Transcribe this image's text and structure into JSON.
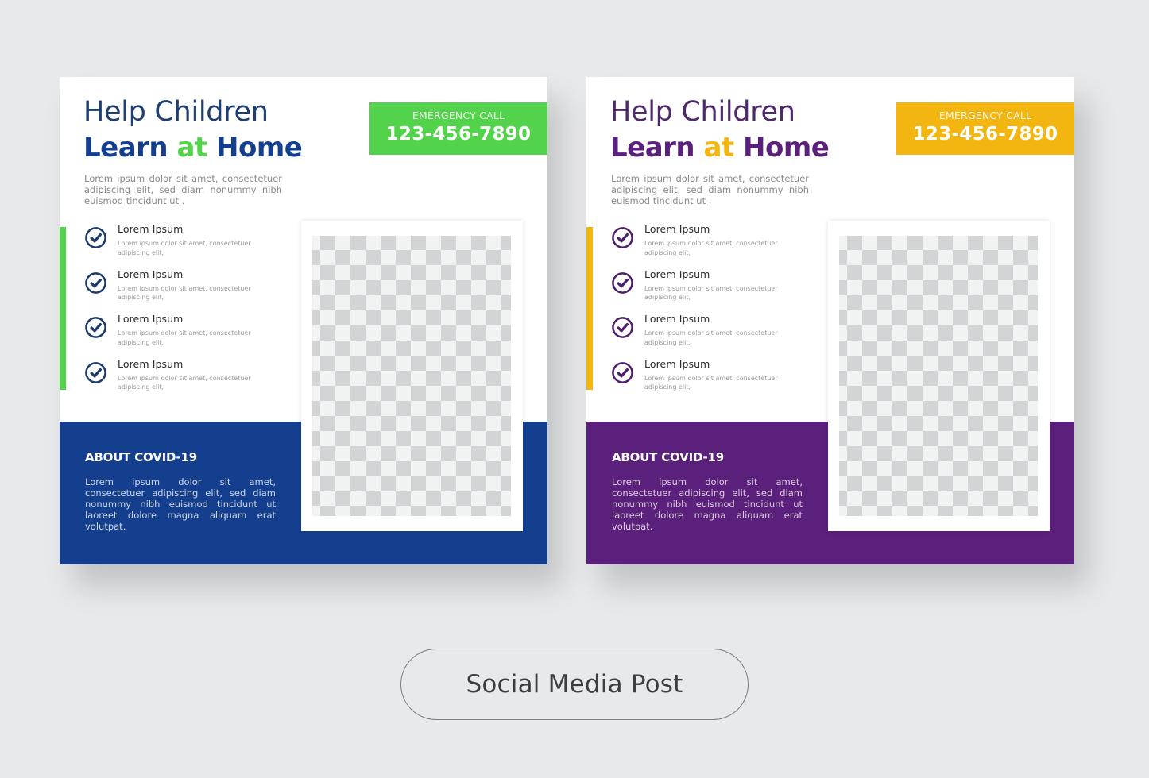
{
  "cards": [
    {
      "theme": {
        "primary": "#143f8f",
        "accent": "#52d34b",
        "headline_light": "#1d3f72",
        "check": "#1c3a6b"
      },
      "headline_line1": "Help Children",
      "headline_line2_part1": "Learn",
      "headline_line2_part2": "at",
      "headline_line2_part3": "Home",
      "intro": "Lorem ipsum dolor sit amet, consectetuer adipiscing elit, sed diam nonummy nibh euismod tincidunt ut .",
      "emergency_label": "EMERGENCY CALL",
      "emergency_phone": "123-456-7890",
      "list": [
        {
          "title": "Lorem Ipsum",
          "desc": "Lorem ipsum dolor sit amet, consectetuer adipiscing elit,",
          "icon": "check-circle-icon"
        },
        {
          "title": "Lorem Ipsum",
          "desc": "Lorem ipsum dolor sit amet, consectetuer adipiscing elit,",
          "icon": "check-circle-icon"
        },
        {
          "title": "Lorem Ipsum",
          "desc": "Lorem ipsum dolor sit amet, consectetuer adipiscing elit,",
          "icon": "check-circle-icon"
        },
        {
          "title": "Lorem Ipsum",
          "desc": "Lorem ipsum dolor sit amet, consectetuer adipiscing elit,",
          "icon": "check-circle-icon"
        }
      ],
      "about_title": "ABOUT COVID-19",
      "about_text": "Lorem ipsum dolor sit amet, consectetuer adipiscing elit, sed diam nonummy nibh euismod tincidunt ut laoreet dolore magna aliquam erat volutpat."
    },
    {
      "theme": {
        "primary": "#5b1f7c",
        "accent": "#f3b50f",
        "headline_light": "#4f2a6b",
        "check": "#4f1f6e"
      },
      "headline_line1": "Help Children",
      "headline_line2_part1": "Learn",
      "headline_line2_part2": "at",
      "headline_line2_part3": "Home",
      "intro": "Lorem ipsum dolor sit amet, consectetuer adipiscing elit, sed diam nonummy nibh euismod tincidunt ut .",
      "emergency_label": "EMERGENCY CALL",
      "emergency_phone": "123-456-7890",
      "list": [
        {
          "title": "Lorem Ipsum",
          "desc": "Lorem ipsum dolor sit amet, consectetuer adipiscing elit,",
          "icon": "check-circle-icon"
        },
        {
          "title": "Lorem Ipsum",
          "desc": "Lorem ipsum dolor sit amet, consectetuer adipiscing elit,",
          "icon": "check-circle-icon"
        },
        {
          "title": "Lorem Ipsum",
          "desc": "Lorem ipsum dolor sit amet, consectetuer adipiscing elit,",
          "icon": "check-circle-icon"
        },
        {
          "title": "Lorem Ipsum",
          "desc": "Lorem ipsum dolor sit amet, consectetuer adipiscing elit,",
          "icon": "check-circle-icon"
        }
      ],
      "about_title": "ABOUT COVID-19",
      "about_text": "Lorem ipsum dolor sit amet, consectetuer adipiscing elit, sed diam nonummy nibh euismod tincidunt ut laoreet dolore magna aliquam erat volutpat."
    }
  ],
  "footer": {
    "label": "Social Media Post"
  },
  "colors": {
    "background": "#e8e9eb",
    "photo_placeholder_light": "#f1f2f2",
    "photo_placeholder_dark": "#d3d4d5"
  }
}
